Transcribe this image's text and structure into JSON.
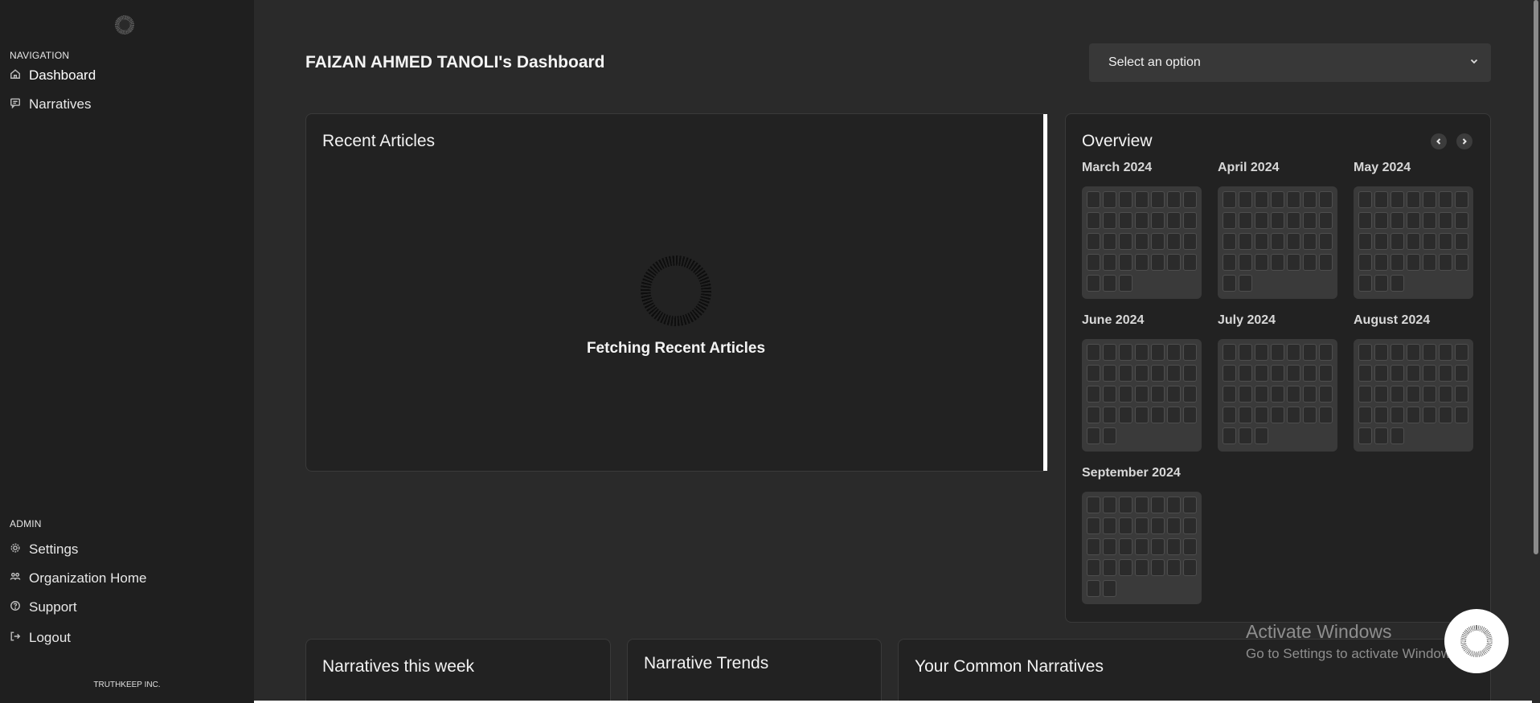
{
  "sidebar": {
    "navigation_label": "NAVIGATION",
    "nav_items": [
      {
        "label": "Dashboard",
        "icon": "home-icon"
      },
      {
        "label": "Narratives",
        "icon": "chat-icon"
      }
    ],
    "admin_label": "ADMIN",
    "admin_items": [
      {
        "label": "Settings",
        "icon": "gear-icon"
      },
      {
        "label": "Organization Home",
        "icon": "users-icon"
      },
      {
        "label": "Support",
        "icon": "help-icon"
      },
      {
        "label": "Logout",
        "icon": "logout-icon"
      }
    ],
    "brand": "TRUTHKEEP INC."
  },
  "header": {
    "title": "FAIZAN AHMED TANOLI's Dashboard",
    "select_value": "Select an option"
  },
  "recent_articles": {
    "title": "Recent Articles",
    "status": "Fetching Recent Articles"
  },
  "overview": {
    "title": "Overview",
    "months": [
      {
        "name": "March 2024",
        "days": 31
      },
      {
        "name": "April 2024",
        "days": 30
      },
      {
        "name": "May 2024",
        "days": 31
      },
      {
        "name": "June 2024",
        "days": 30
      },
      {
        "name": "July 2024",
        "days": 31
      },
      {
        "name": "August 2024",
        "days": 31
      },
      {
        "name": "September 2024",
        "days": 30
      }
    ]
  },
  "bottom_panels": {
    "narratives_week": "Narratives this week",
    "narrative_trends": "Narrative Trends",
    "common_narratives": "Your Common Narratives"
  },
  "watermark": {
    "line1": "Activate Windows",
    "line2": "Go to Settings to activate Windows."
  }
}
